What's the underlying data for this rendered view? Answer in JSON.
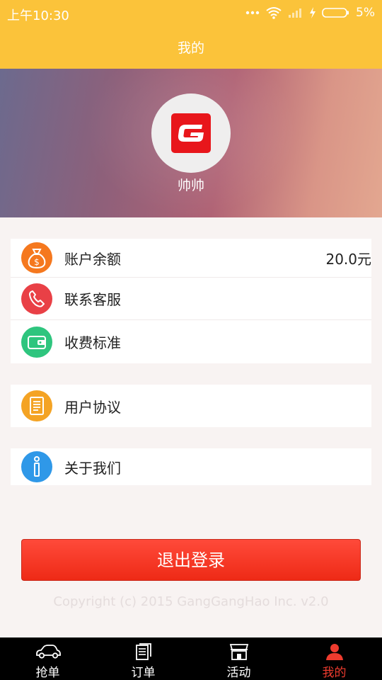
{
  "status_bar": {
    "time": "上午10:30",
    "battery": "5%"
  },
  "header": {
    "title": "我的"
  },
  "profile": {
    "name": "帅帅"
  },
  "menu_group_1": [
    {
      "label": "账户余额",
      "value": "20.0元",
      "icon": "money-bag-icon"
    },
    {
      "label": "联系客服",
      "icon": "phone-icon"
    },
    {
      "label": "收费标准",
      "icon": "wallet-icon"
    }
  ],
  "menu_group_2": [
    {
      "label": "用户协议",
      "icon": "document-icon"
    }
  ],
  "menu_group_3": [
    {
      "label": "关于我们",
      "icon": "info-icon"
    }
  ],
  "logout_label": "退出登录",
  "copyright": "Copyright (c) 2015 GangGangHao Inc. v2.0",
  "tabs": [
    {
      "label": "抢单",
      "icon": "car-icon"
    },
    {
      "label": "订单",
      "icon": "orders-icon"
    },
    {
      "label": "活动",
      "icon": "shop-icon"
    },
    {
      "label": "我的",
      "icon": "user-icon",
      "active": true
    }
  ],
  "colors": {
    "header": "#fbc33a",
    "accent_red": "#ee2a16",
    "icon_orange": "#f5781e",
    "icon_red": "#e94046",
    "icon_green": "#2ec57e",
    "icon_amber": "#f4a324",
    "icon_blue": "#2f98e8"
  }
}
